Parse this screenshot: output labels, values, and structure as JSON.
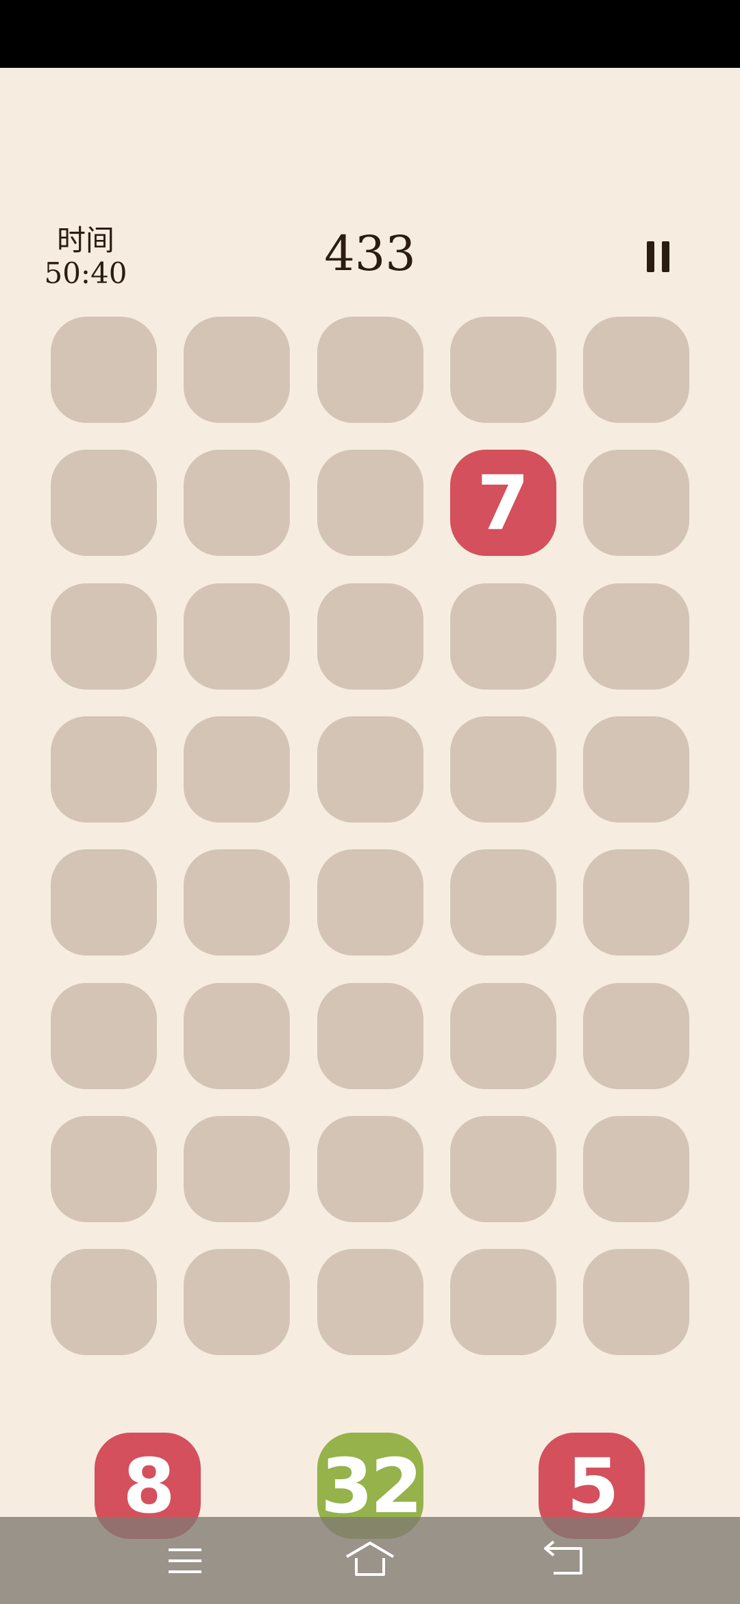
{
  "header": {
    "time_label": "时间",
    "time_value": "50:40",
    "score": "433"
  },
  "board": {
    "rows": 8,
    "cols": 5,
    "cell_color": "#d3c4b6",
    "tiles": [
      {
        "row": 1,
        "col": 3,
        "value": "7",
        "color": "#d4505c"
      }
    ]
  },
  "queue": {
    "tiles": [
      {
        "value": "8",
        "color": "#d4505c"
      },
      {
        "value": "32",
        "color": "#95b24b"
      },
      {
        "value": "5",
        "color": "#d4505c"
      }
    ]
  },
  "colors": {
    "background": "#f6ede0",
    "text": "#2b1c12",
    "status_bar": "#000000"
  },
  "icons": {
    "pause": "pause-icon",
    "nav_menu": "menu-icon",
    "nav_home": "home-icon",
    "nav_back": "back-icon"
  }
}
